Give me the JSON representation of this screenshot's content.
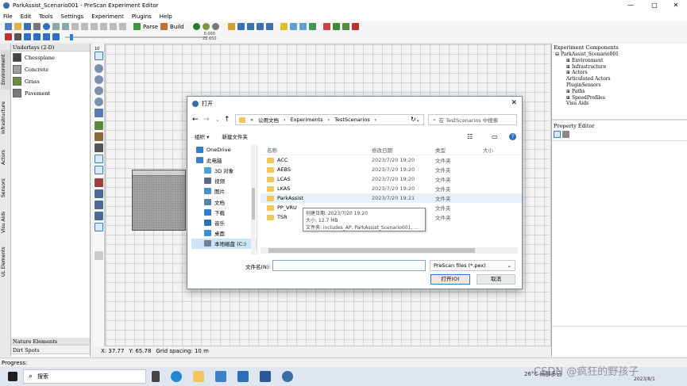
{
  "window": {
    "title": "ParkAssist_Scenario001 - PreScan Experiment Editor"
  },
  "menu": [
    "File",
    "Edit",
    "Tools",
    "Settings",
    "Experiment",
    "Plugins",
    "Help"
  ],
  "toolbar": {
    "parse_label": "Parse",
    "build_label": "Build",
    "time_top": "0.000",
    "time_bottom": "21.650"
  },
  "left_tabs": [
    "Environment",
    "Infrastructure",
    "Actors",
    "Sensors",
    "Visu Aids",
    "UL Elements"
  ],
  "underlays": {
    "header": "Underlays (2-D)",
    "items": [
      {
        "label": "Chessplane",
        "color": "#444444"
      },
      {
        "label": "Concrete",
        "color": "#9e9e9e"
      },
      {
        "label": "Grass",
        "color": "#6b8f3a"
      },
      {
        "label": "Pavement",
        "color": "#7a7a7a"
      }
    ],
    "footer1": "Nature Elements",
    "footer2": "Dirt Spots"
  },
  "ruler": {
    "label": "10"
  },
  "experiment_components": {
    "header": "Experiment Components",
    "items": [
      "ParkAssist_Scenario001",
      "Environment",
      "Infrastructure",
      "Actors",
      "Articulated Actors",
      "PluginSensors",
      "Paths",
      "SpeedProfiles",
      "Visu Aids"
    ]
  },
  "property_editor": {
    "header": "Property Editor"
  },
  "status": {
    "x": "X: 37.77",
    "y": "Y: 65.78",
    "grid": "Grid spacing: 10 m"
  },
  "progress_label": "Progress:",
  "taskbar": {
    "search": "搜索",
    "weather": "26°C 局部多云",
    "date": "2023/8/1"
  },
  "watermark": "CSDN @疯狂的野孩子",
  "dialog": {
    "title": "打开",
    "breadcrumb": [
      "公用文档",
      "Experiments",
      "TestScenarios"
    ],
    "search_placeholder": "在 TestScenarios 中搜索",
    "organize": "组织 ▾",
    "new_folder": "新建文件夹",
    "nav": [
      {
        "label": "OneDrive",
        "color": "#2d7dd2"
      },
      {
        "label": "此电脑",
        "color": "#3c7fc4"
      },
      {
        "label": "3D 对象",
        "color": "#4aa3d8"
      },
      {
        "label": "视频",
        "color": "#5a6b86"
      },
      {
        "label": "图片",
        "color": "#4a8fd0"
      },
      {
        "label": "文档",
        "color": "#5b7fa6"
      },
      {
        "label": "下载",
        "color": "#2d7dd2"
      },
      {
        "label": "音乐",
        "color": "#2a6fb8"
      },
      {
        "label": "桌面",
        "color": "#3b8ed6"
      },
      {
        "label": "本地磁盘 (C:)",
        "color": "#6f7f95"
      }
    ],
    "columns": [
      "名称",
      "修改日期",
      "类型",
      "大小"
    ],
    "files": [
      {
        "name": "ACC",
        "date": "2023/7/20 19:20",
        "type": "文件夹"
      },
      {
        "name": "AEBS",
        "date": "2023/7/20 19:20",
        "type": "文件夹"
      },
      {
        "name": "LCAS",
        "date": "2023/7/20 19:20",
        "type": "文件夹"
      },
      {
        "name": "LKAS",
        "date": "2023/7/20 19:20",
        "type": "文件夹"
      },
      {
        "name": "ParkAssist",
        "date": "2023/7/20 19:21",
        "type": "文件夹"
      },
      {
        "name": "PP_VRU",
        "date": "",
        "type": "文件夹"
      },
      {
        "name": "TSR",
        "date": "",
        "type": "文件夹"
      }
    ],
    "tooltip": [
      "创建日期: 2023/7/20 19:20",
      "大小: 12.7 MB",
      "文件夹: includes_AP, ParkAssist_Scenario001, ..."
    ],
    "filename_label": "文件名(N):",
    "filename_value": "",
    "filetype": "PreScan files (*.pex)",
    "open_btn": "打开(O)",
    "cancel_btn": "取消"
  }
}
